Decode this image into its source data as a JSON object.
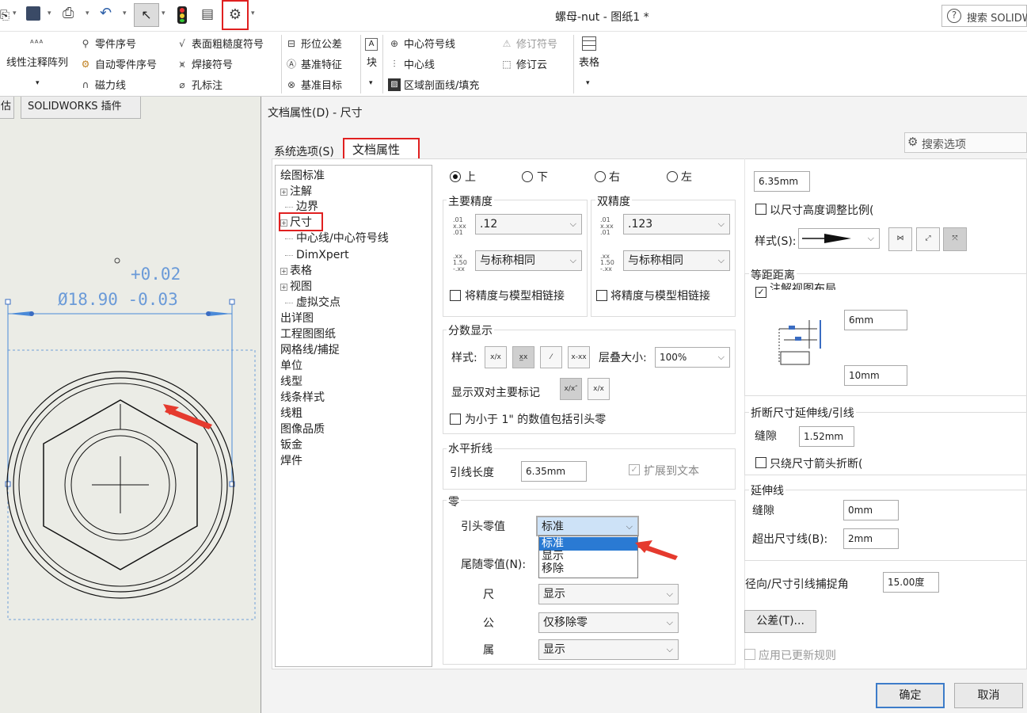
{
  "window": {
    "title": "螺母-nut - 图纸1 *",
    "search_placeholder": "搜索 SOLIDW"
  },
  "ribbon": {
    "linear_note_array": "线性注释阵列",
    "part_number": "零件序号",
    "auto_part_number": "自动零件序号",
    "magnetic_line": "磁力线",
    "surface_finish": "表面粗糙度符号",
    "weld_symbol": "焊接符号",
    "hole_callout": "孔标注",
    "gtol": "形位公差",
    "datum_feature": "基准特征",
    "datum_target": "基准目标",
    "block": "块",
    "center_mark": "中心符号线",
    "centerline": "中心线",
    "area_hatch": "区域剖面线/填充",
    "revision_symbol": "修订符号",
    "revision_cloud": "修订云",
    "table": "表格"
  },
  "tabs": [
    "估",
    "SOLIDWORKS 插件"
  ],
  "drawing": {
    "tol_upper": "+0.02",
    "dim_main": "Ø18.90 -0.03"
  },
  "dialog": {
    "title": "文档属性(D) - 尺寸",
    "tab_system": "系统选项(S)",
    "tab_document": "文档属性(D)",
    "search_options": "搜索选项",
    "tree": [
      {
        "label": "绘图标准",
        "indent": 0,
        "expand": false
      },
      {
        "label": "注解",
        "indent": 0,
        "expand": true
      },
      {
        "label": "边界",
        "indent": 1,
        "expand": false
      },
      {
        "label": "尺寸",
        "indent": 0,
        "expand": true
      },
      {
        "label": "中心线/中心符号线",
        "indent": 1,
        "expand": false
      },
      {
        "label": "DimXpert",
        "indent": 1,
        "expand": false
      },
      {
        "label": "表格",
        "indent": 0,
        "expand": true
      },
      {
        "label": "视图",
        "indent": 0,
        "expand": true
      },
      {
        "label": "虚拟交点",
        "indent": 1,
        "expand": false
      },
      {
        "label": "出详图",
        "indent": 0,
        "expand": false
      },
      {
        "label": "工程图图纸",
        "indent": 0,
        "expand": false
      },
      {
        "label": "网格线/捕捉",
        "indent": 0,
        "expand": false
      },
      {
        "label": "单位",
        "indent": 0,
        "expand": false
      },
      {
        "label": "线型",
        "indent": 0,
        "expand": false
      },
      {
        "label": "线条样式",
        "indent": 0,
        "expand": false
      },
      {
        "label": "线粗",
        "indent": 0,
        "expand": false
      },
      {
        "label": "图像品质",
        "indent": 0,
        "expand": false
      },
      {
        "label": "钣金",
        "indent": 0,
        "expand": false
      },
      {
        "label": "焊件",
        "indent": 0,
        "expand": false
      }
    ],
    "position": {
      "top": "上",
      "bottom": "下",
      "right": "右",
      "left": "左"
    },
    "primary_precision": {
      "title": "主要精度",
      "value": ".12",
      "tol": "与标称相同",
      "link": "将精度与模型相链接"
    },
    "dual_precision": {
      "title": "双精度",
      "value": ".123",
      "tol": "与标称相同",
      "link": "将精度与模型相链接"
    },
    "fraction": {
      "title": "分数显示",
      "style": "样式:",
      "stack_size": "层叠大小:",
      "stack_value": "100%",
      "show_dual": "显示双对主要标记",
      "leading_zero": "为小于 1\" 的数值包括引头零"
    },
    "horizontal": {
      "title": "水平折线",
      "leader_length": "引线长度",
      "leader_value": "6.35mm",
      "extend_text": "扩展到文本"
    },
    "zeros": {
      "title": "零",
      "leading": "引头零值",
      "leading_value": "标准",
      "trailing": "尾随零值(N):",
      "dim": "尺",
      "dim_value": "显示",
      "tol": "公",
      "tol_value": "仅移除零",
      "prop": "属",
      "prop_value": "显示"
    },
    "dropdown_options": [
      "标准",
      "显示",
      "移除"
    ],
    "right": {
      "top_value": "6.35mm",
      "scale_height": "以尺寸高度调整比例(",
      "style": "样式(S):",
      "offset_title": "等距距离",
      "offset_check": "注解视图布局",
      "offset_1": "6mm",
      "offset_2": "10mm",
      "break_title": "折断尺寸延伸线/引线",
      "gap": "缝隙",
      "break_gap": "1.52mm",
      "break_only": "只绕尺寸箭头折断(",
      "ext_title": "延伸线",
      "ext_gap": "0mm",
      "beyond": "超出尺寸线(B):",
      "beyond_value": "2mm",
      "radial_snap": "径向/尺寸引线捕捉角",
      "radial_value": "15.00度",
      "tolerance_btn": "公差(T)...",
      "apply_updated": "应用已更新规则"
    },
    "ok": "确定",
    "cancel": "取消"
  }
}
